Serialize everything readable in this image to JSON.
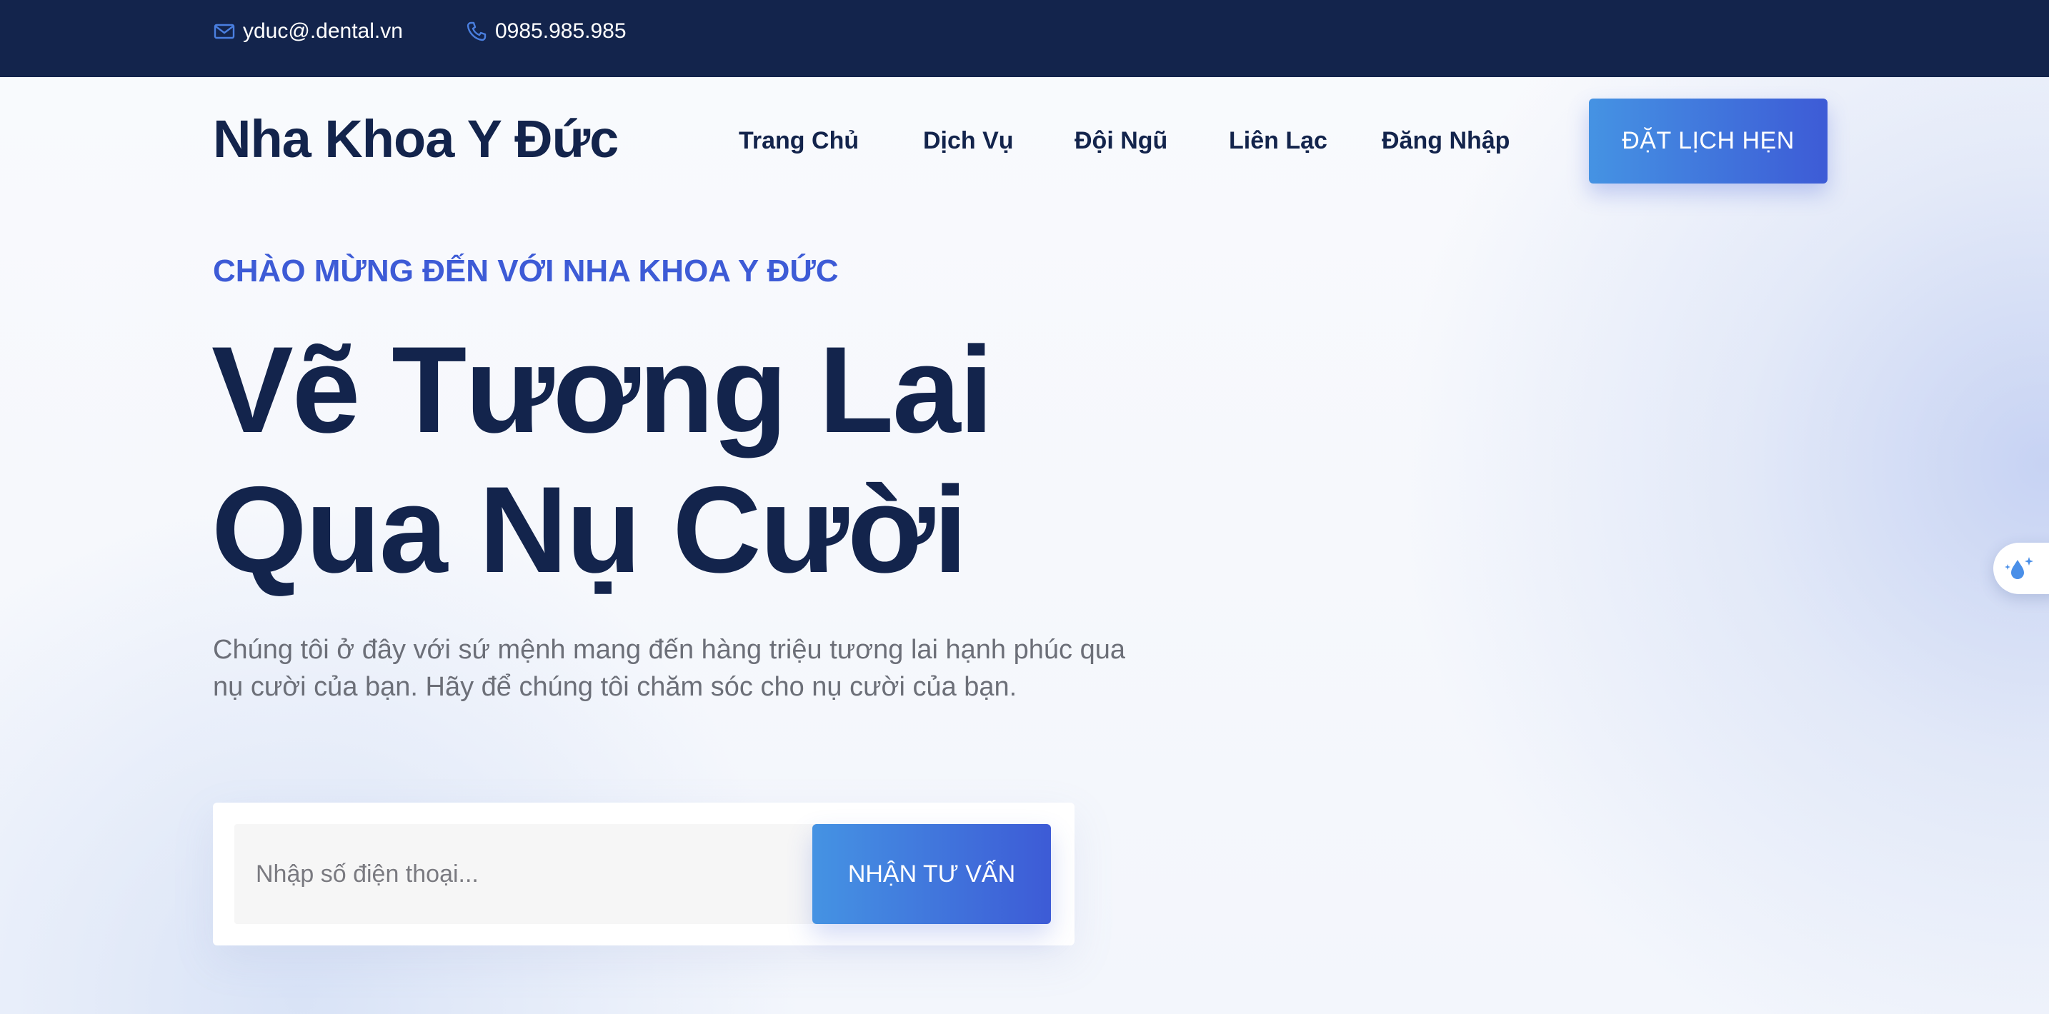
{
  "topbar": {
    "email": "yduc@.dental.vn",
    "phone": "0985.985.985",
    "email_icon": "envelope-icon",
    "phone_icon": "phone-icon"
  },
  "header": {
    "logo": "Nha Khoa Y Đức",
    "nav": [
      {
        "label": "Trang Chủ"
      },
      {
        "label": "Dịch Vụ"
      },
      {
        "label": "Đội Ngũ"
      },
      {
        "label": "Liên Lạc"
      },
      {
        "label": "Đăng Nhập"
      }
    ],
    "cta": "ĐẶT LỊCH HẸN"
  },
  "hero": {
    "eyebrow": "CHÀO MỪNG ĐẾN VỚI NHA KHOA Y ĐỨC",
    "headline_line1": "Vẽ Tương Lai",
    "headline_line2": "Qua Nụ Cười",
    "description": "Chúng tôi ở đây với sứ mệnh mang đến hàng triệu tương lai hạnh phúc qua nụ cười của bạn. Hãy để chúng tôi chăm sóc cho nụ cười của bạn."
  },
  "form": {
    "phone_placeholder": "Nhập số điện thoại...",
    "phone_value": "",
    "submit": "NHẬN TƯ VẤN"
  },
  "side_widget": {
    "icon": "droplet-sparkle-icon"
  },
  "colors": {
    "navy": "#13244c",
    "accent": "#3d5bd6",
    "accent_light": "#4593e3",
    "muted_text": "#6c6f78"
  }
}
